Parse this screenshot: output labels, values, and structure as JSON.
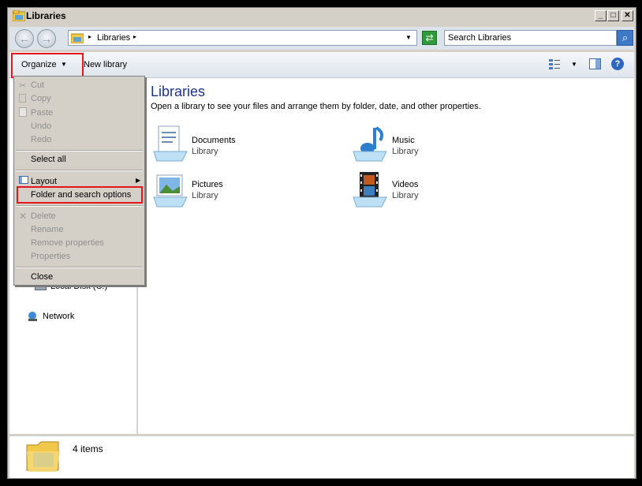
{
  "window": {
    "title": "Libraries"
  },
  "address": {
    "crumb": "Libraries"
  },
  "search": {
    "placeholder": "Search Libraries"
  },
  "toolbar": {
    "organize_label": "Organize",
    "new_library_label": "New library"
  },
  "organize_menu": {
    "cut": "Cut",
    "copy": "Copy",
    "paste": "Paste",
    "undo": "Undo",
    "redo": "Redo",
    "select_all": "Select all",
    "layout": "Layout",
    "folder_options": "Folder and search options",
    "delete": "Delete",
    "rename": "Rename",
    "remove_properties": "Remove properties",
    "properties": "Properties",
    "close": "Close"
  },
  "content": {
    "heading": "Libraries",
    "description": "Open a library to see your files and arrange them by folder, date, and other properties.",
    "libraries": [
      {
        "name": "Documents",
        "type": "Library"
      },
      {
        "name": "Music",
        "type": "Library"
      },
      {
        "name": "Pictures",
        "type": "Library"
      },
      {
        "name": "Videos",
        "type": "Library"
      }
    ]
  },
  "navpane": {
    "local_disk": "Local Disk (C:)",
    "network": "Network"
  },
  "status": {
    "items": "4 items"
  },
  "colors": {
    "highlight": "#e5161b",
    "heading": "#1e3287"
  }
}
